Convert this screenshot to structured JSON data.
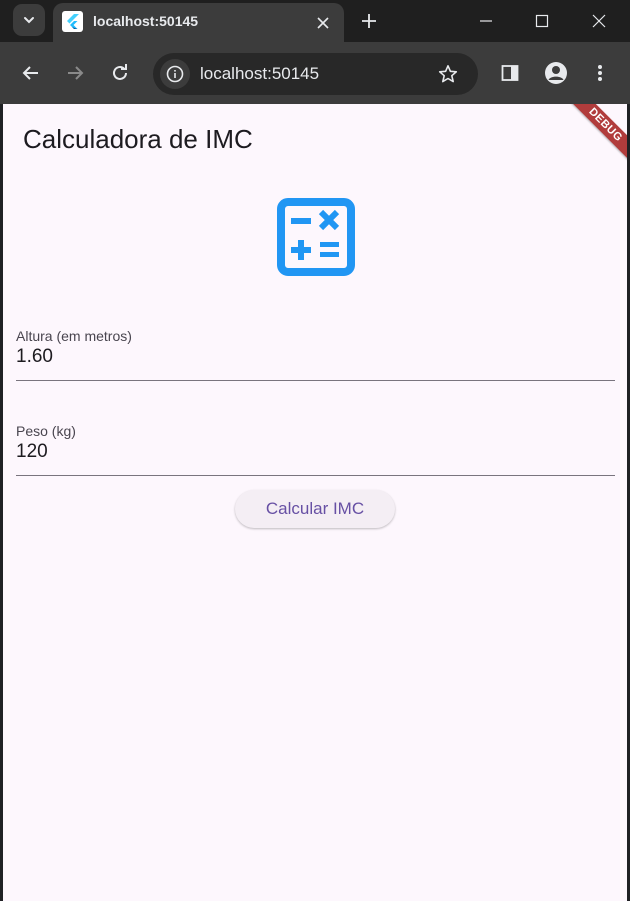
{
  "browser": {
    "tab_title": "localhost:50145",
    "url": "localhost:50145"
  },
  "app": {
    "title": "Calculadora de IMC",
    "debug_banner": "DEBUG",
    "icon": "calculator-icon",
    "accent_color": "#2196f3",
    "height_field": {
      "label": "Altura (em metros)",
      "value": "1.60"
    },
    "weight_field": {
      "label": "Peso (kg)",
      "value": "120"
    },
    "calculate_button": "Calcular IMC"
  }
}
